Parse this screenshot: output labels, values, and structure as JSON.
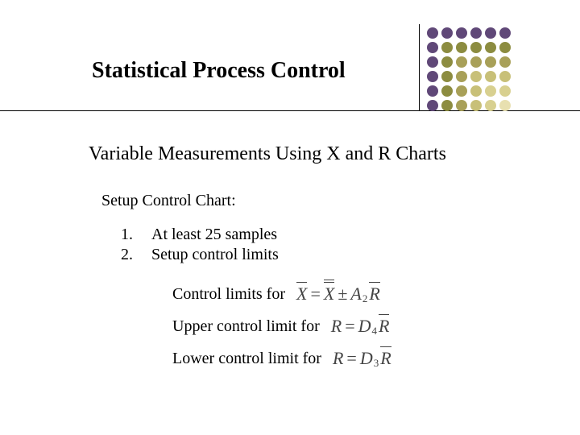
{
  "title": "Statistical Process Control",
  "subtitle": "Variable Measurements Using X and R Charts",
  "setup_heading": "Setup Control Chart:",
  "list": {
    "n1": "1.",
    "n2": "2.",
    "item1": "At least 25 samples",
    "item2": "Setup control limits"
  },
  "formulas": {
    "line1_label": "Control limits for",
    "line2_label": "Upper control limit for",
    "line3_label": "Lower control limit for",
    "X": "X",
    "R": "R",
    "eq": "=",
    "pm": "±",
    "A": "A",
    "D": "D",
    "sub2": "2",
    "sub3": "3",
    "sub4": "4"
  }
}
